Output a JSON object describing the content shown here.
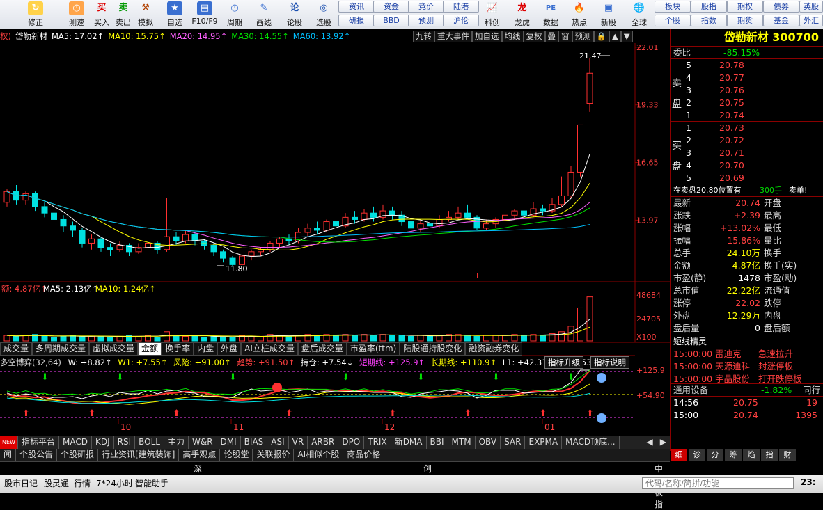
{
  "toolbar": {
    "items": [
      "修正",
      "测速",
      "买入",
      "卖出",
      "模拟",
      "自选",
      "F10/F9",
      "周期",
      "画线",
      "论股",
      "选股"
    ],
    "right_left": [
      "资讯",
      "研报",
      "资金",
      "BBD",
      "竞价",
      "预测",
      "陆港",
      "沪伦"
    ],
    "right_icons": [
      "科创",
      "龙虎",
      "数据",
      "热点",
      "新股",
      "全球"
    ],
    "right_right": [
      "板块",
      "个股",
      "股指",
      "指数",
      "期权",
      "期货",
      "债券",
      "基金",
      "英股",
      "外汇"
    ]
  },
  "info": {
    "prefix": "权)",
    "name": "岱勒新材",
    "ma5": "MA5: 17.02↑",
    "ma10": "MA10: 15.75↑",
    "ma20": "MA20: 14.95↑",
    "ma30": "MA30: 14.55↑",
    "ma60": "MA60: 13.92↑",
    "c_ma5": "#ffffff",
    "c_ma10": "#ffff00",
    "c_ma20": "#ff60ff",
    "c_ma30": "#00e000",
    "c_ma60": "#00c0ff"
  },
  "chart_tabs": [
    "九转",
    "重大事件",
    "加自选",
    "均线",
    "复权",
    "叠",
    "窗",
    "预测",
    "🔒",
    "▲",
    "▼"
  ],
  "chart_data": {
    "type": "candlestick",
    "price_ticks": [
      "22.01",
      "19.33",
      "16.65",
      "13.97"
    ],
    "high_label": "21.47",
    "low_label": "11.80",
    "x_labels": [
      "10",
      "11",
      "12",
      "01"
    ],
    "vol_ticks": [
      "48684",
      "24705",
      "X100"
    ],
    "vol_info": "额: 4.87亿↑",
    "vol_ma5": "MA5: 2.13亿↑",
    "vol_ma10": "MA10: 1.24亿↑",
    "ind_ticks": [
      "+125.9",
      "+54.90"
    ],
    "candles": [
      [
        14.8,
        15.3,
        15.4,
        14.6
      ],
      [
        15.3,
        14.9,
        15.6,
        14.7
      ],
      [
        14.9,
        15.2,
        15.3,
        14.7
      ],
      [
        15.2,
        14.6,
        15.3,
        14.4
      ],
      [
        14.6,
        14.3,
        14.8,
        14.1
      ],
      [
        14.3,
        14.0,
        14.5,
        13.8
      ],
      [
        14.0,
        13.7,
        14.2,
        13.4
      ],
      [
        13.7,
        13.5,
        13.9,
        13.2
      ],
      [
        13.5,
        12.9,
        13.6,
        12.7
      ],
      [
        12.9,
        13.1,
        13.3,
        12.6
      ],
      [
        13.1,
        12.7,
        13.2,
        12.5
      ],
      [
        12.7,
        12.6,
        12.9,
        12.3
      ],
      [
        12.6,
        12.8,
        13.0,
        12.5
      ],
      [
        12.8,
        12.5,
        12.9,
        12.3
      ],
      [
        12.5,
        12.7,
        12.9,
        12.4
      ],
      [
        12.7,
        12.9,
        13.0,
        12.5
      ],
      [
        12.9,
        12.6,
        13.0,
        12.4
      ],
      [
        12.6,
        13.2,
        15.0,
        12.5
      ],
      [
        13.2,
        13.0,
        13.4,
        12.8
      ],
      [
        13.0,
        13.3,
        13.5,
        12.9
      ],
      [
        13.3,
        13.0,
        13.4,
        12.8
      ],
      [
        13.0,
        12.8,
        13.1,
        12.6
      ],
      [
        12.8,
        12.5,
        12.9,
        12.3
      ],
      [
        12.5,
        12.2,
        12.6,
        12.0
      ],
      [
        12.2,
        11.9,
        12.3,
        11.8
      ],
      [
        11.9,
        12.3,
        12.4,
        11.8
      ],
      [
        12.3,
        12.5,
        12.6,
        12.1
      ],
      [
        12.5,
        12.6,
        12.7,
        12.3
      ],
      [
        12.6,
        12.9,
        13.0,
        12.5
      ],
      [
        12.9,
        13.1,
        13.2,
        12.7
      ],
      [
        13.1,
        13.0,
        13.3,
        12.8
      ],
      [
        13.0,
        13.4,
        13.6,
        12.9
      ],
      [
        13.4,
        13.6,
        13.8,
        13.2
      ],
      [
        13.6,
        13.5,
        13.9,
        13.3
      ],
      [
        13.5,
        13.9,
        14.0,
        13.4
      ],
      [
        13.9,
        13.7,
        14.1,
        13.5
      ],
      [
        13.7,
        14.1,
        14.3,
        13.6
      ],
      [
        14.1,
        14.0,
        14.4,
        13.8
      ],
      [
        14.0,
        14.3,
        14.5,
        13.9
      ],
      [
        14.3,
        14.1,
        14.6,
        13.9
      ],
      [
        14.1,
        14.4,
        14.7,
        14.0
      ],
      [
        14.4,
        14.2,
        14.6,
        14.0
      ],
      [
        14.2,
        13.9,
        14.4,
        13.7
      ],
      [
        13.9,
        13.6,
        14.0,
        13.4
      ],
      [
        13.6,
        13.8,
        14.0,
        13.4
      ],
      [
        13.8,
        13.7,
        14.0,
        13.5
      ],
      [
        13.7,
        14.0,
        14.2,
        13.6
      ],
      [
        14.0,
        14.1,
        14.4,
        13.9
      ],
      [
        14.1,
        14.3,
        14.6,
        14.0
      ],
      [
        14.3,
        14.1,
        14.7,
        14.0
      ],
      [
        14.1,
        13.6,
        14.2,
        13.5
      ],
      [
        13.6,
        13.8,
        14.0,
        13.5
      ],
      [
        13.8,
        14.0,
        14.1,
        13.6
      ],
      [
        14.0,
        14.2,
        14.4,
        13.9
      ],
      [
        14.2,
        14.4,
        14.5,
        14.0
      ],
      [
        14.4,
        14.2,
        14.6,
        14.0
      ],
      [
        14.2,
        14.5,
        14.8,
        14.1
      ],
      [
        14.5,
        14.4,
        14.7,
        14.2
      ],
      [
        14.4,
        14.7,
        15.0,
        14.3
      ],
      [
        14.7,
        15.1,
        16.0,
        14.6
      ],
      [
        15.1,
        16.2,
        16.5,
        15.0
      ],
      [
        16.2,
        18.4,
        18.4,
        16.0
      ],
      [
        19.4,
        20.8,
        21.5,
        19.0
      ]
    ],
    "vol_bars": [
      6,
      5,
      6,
      7,
      5,
      4,
      5,
      6,
      5,
      5,
      5,
      4,
      5,
      6,
      5,
      6,
      4,
      10,
      6,
      5,
      5,
      4,
      5,
      4,
      4,
      6,
      5,
      5,
      7,
      6,
      5,
      6,
      7,
      6,
      7,
      6,
      7,
      6,
      7,
      6,
      7,
      6,
      6,
      5,
      6,
      5,
      6,
      7,
      7,
      6,
      5,
      6,
      6,
      6,
      7,
      6,
      7,
      6,
      8,
      10,
      16,
      36,
      48
    ]
  },
  "tab_bar": [
    "成交量",
    "多周期成交量",
    "虚拟成交量",
    "金额",
    "换手率",
    "内盘",
    "外盘",
    "AI立桩成交量",
    "盘后成交量",
    "市盈率(ttm)",
    "陆股通持股变化",
    "融资融券变化"
  ],
  "ind2": {
    "name": "多空博弈",
    "params": "(32,64)",
    "w": "W: +8.82↑",
    "w1": "W1: +7.55↑",
    "risk": "风险: +91.00↑",
    "trend": "趋势: +91.50↑",
    "hold": "持仓: +7.54↓",
    "short": "短期线: +125.9↑",
    "long": "长期线: +110.9↑",
    "l1": "L1: +42.31↓",
    "l2": "L2: +53.36↓",
    "btn1": "指标升级",
    "btn2": "指标说明"
  },
  "bottom_tabs": [
    "NEW",
    "指标平台",
    "MACD",
    "KDJ",
    "RSI",
    "BOLL",
    "主力",
    "W&R",
    "DMI",
    "BIAS",
    "ASI",
    "VR",
    "ARBR",
    "DPO",
    "TRIX",
    "新DMA",
    "BBI",
    "MTM",
    "OBV",
    "SAR",
    "EXPMA",
    "MACD顶底..."
  ],
  "info_tabs": [
    "闻",
    "个股公告",
    "个股研报",
    "行业资讯[建筑装饰]",
    "高手观点",
    "论股堂",
    "关联报价",
    "AI相似个股",
    "商品价格"
  ],
  "market_bar": [
    "深",
    "创",
    "中小板指"
  ],
  "status": {
    "items": [
      "股市日记",
      "股灵通",
      "行情",
      "7*24小时",
      "智能助手"
    ],
    "search_ph": "代码/名称/简拼/功能",
    "time": "23:"
  },
  "quote": {
    "title": "岱勒新材 300700",
    "wb_label": "委比",
    "wb": "-85.15%",
    "sell_label": "卖盘",
    "buy_label": "买盘",
    "sells": [
      [
        "5",
        "20.78"
      ],
      [
        "4",
        "20.77"
      ],
      [
        "3",
        "20.76"
      ],
      [
        "2",
        "20.75"
      ],
      [
        "1",
        "20.74"
      ]
    ],
    "buys": [
      [
        "1",
        "20.73"
      ],
      [
        "2",
        "20.72"
      ],
      [
        "3",
        "20.71"
      ],
      [
        "4",
        "20.70"
      ],
      [
        "5",
        "20.69"
      ]
    ],
    "alert": "在卖盘20.80位置有",
    "alert_qty": "300手",
    "alert_end": "卖单!",
    "rows": [
      [
        "最新",
        "20.74",
        "开盘"
      ],
      [
        "涨跌",
        "+2.39",
        "最高"
      ],
      [
        "涨幅",
        "+13.02%",
        "最低"
      ],
      [
        "振幅",
        "15.86%",
        "量比"
      ],
      [
        "总手",
        "24.10万",
        "换手"
      ],
      [
        "金额",
        "4.87亿",
        "换手(实)"
      ],
      [
        "市盈(静)",
        "1478",
        "市盈(动)"
      ],
      [
        "总市值",
        "22.22亿",
        "流通值"
      ],
      [
        "涨停",
        "22.02",
        "跌停"
      ],
      [
        "外盘",
        "12.29万",
        "内盘"
      ],
      [
        "盘后量",
        "0",
        "盘后额"
      ]
    ],
    "sm_title": "短线精灵",
    "sm": [
      [
        "15:00:00",
        "雷迪克",
        "急速拉升"
      ],
      [
        "15:00:00",
        "天源迪科",
        "封涨停板"
      ],
      [
        "15:00:00",
        "宇晶股份",
        "打开跌停板"
      ]
    ],
    "ts_label": "通用设备",
    "ts_val": "-1.82%",
    "ts_btn": "同行",
    "ticks": [
      [
        "14:56",
        "20.75",
        "19"
      ],
      [
        "15:00",
        "20.74",
        "1395"
      ]
    ],
    "detail_tabs": [
      "细",
      "诊",
      "分",
      "筹",
      "焰",
      "指",
      "财"
    ]
  }
}
